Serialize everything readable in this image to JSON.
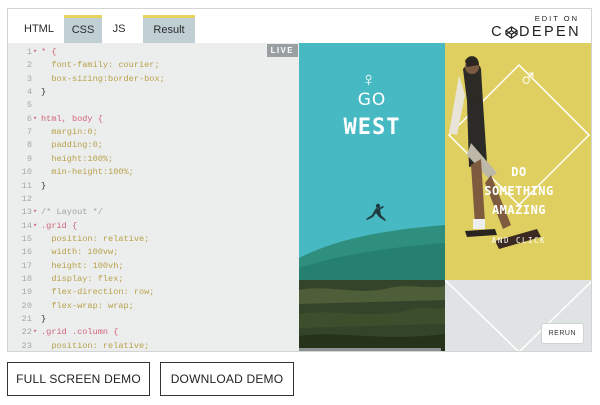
{
  "tabs": [
    {
      "label": "HTML",
      "active": false
    },
    {
      "label": "CSS",
      "active": true
    },
    {
      "label": "JS",
      "active": false
    },
    {
      "label": "Result",
      "active": true
    }
  ],
  "brand": {
    "edit_on": "EDIT ON",
    "name_left": "C",
    "name_right": "DEPEN"
  },
  "editor": {
    "live_label": "LIVE",
    "lines": [
      {
        "n": "1",
        "fold": true,
        "parts": [
          [
            "sel",
            "* {"
          ]
        ]
      },
      {
        "n": "2",
        "fold": false,
        "parts": [
          [
            "prop",
            "  font-family: courier;"
          ]
        ]
      },
      {
        "n": "3",
        "fold": false,
        "parts": [
          [
            "prop",
            "  box-sizing:border-box;"
          ]
        ]
      },
      {
        "n": "4",
        "fold": false,
        "parts": [
          [
            "plain",
            "}"
          ]
        ]
      },
      {
        "n": "5",
        "fold": false,
        "parts": [
          [
            "plain",
            ""
          ]
        ]
      },
      {
        "n": "6",
        "fold": true,
        "parts": [
          [
            "sel",
            "html, body {"
          ]
        ]
      },
      {
        "n": "7",
        "fold": false,
        "parts": [
          [
            "prop",
            "  margin:0;"
          ]
        ]
      },
      {
        "n": "8",
        "fold": false,
        "parts": [
          [
            "prop",
            "  padding:0;"
          ]
        ]
      },
      {
        "n": "9",
        "fold": false,
        "parts": [
          [
            "prop",
            "  height:100%;"
          ]
        ]
      },
      {
        "n": "10",
        "fold": false,
        "parts": [
          [
            "prop",
            "  min-height:100%;"
          ]
        ]
      },
      {
        "n": "11",
        "fold": false,
        "parts": [
          [
            "plain",
            "}"
          ]
        ]
      },
      {
        "n": "12",
        "fold": false,
        "parts": [
          [
            "plain",
            ""
          ]
        ]
      },
      {
        "n": "13",
        "fold": true,
        "parts": [
          [
            "cmt",
            "/* Layout */"
          ]
        ]
      },
      {
        "n": "14",
        "fold": true,
        "parts": [
          [
            "sel",
            ".grid {"
          ]
        ]
      },
      {
        "n": "15",
        "fold": false,
        "parts": [
          [
            "prop",
            "  position: relative;"
          ]
        ]
      },
      {
        "n": "16",
        "fold": false,
        "parts": [
          [
            "prop",
            "  width: 100vw;"
          ]
        ]
      },
      {
        "n": "17",
        "fold": false,
        "parts": [
          [
            "prop",
            "  height: 100vh;"
          ]
        ]
      },
      {
        "n": "18",
        "fold": false,
        "parts": [
          [
            "prop",
            "  display: flex;"
          ]
        ]
      },
      {
        "n": "19",
        "fold": false,
        "parts": [
          [
            "prop",
            "  flex-direction: row;"
          ]
        ]
      },
      {
        "n": "20",
        "fold": false,
        "parts": [
          [
            "prop",
            "  flex-wrap: wrap;"
          ]
        ]
      },
      {
        "n": "21",
        "fold": false,
        "parts": [
          [
            "plain",
            "}"
          ]
        ]
      },
      {
        "n": "22",
        "fold": true,
        "parts": [
          [
            "sel",
            ".grid .column {"
          ]
        ]
      },
      {
        "n": "23",
        "fold": false,
        "parts": [
          [
            "prop",
            "  position: relative;"
          ]
        ]
      }
    ]
  },
  "result": {
    "female_symbol": "♀",
    "go": "GO",
    "west": "WEST",
    "male_symbol": "♂",
    "do_lines": [
      "DO",
      "SOMETHING",
      "AMAZING"
    ],
    "click": "AND CLICK",
    "rerun": "RERUN"
  },
  "buttons": {
    "full_screen": "FULL SCREEN DEMO",
    "download": "DOWNLOAD DEMO"
  }
}
